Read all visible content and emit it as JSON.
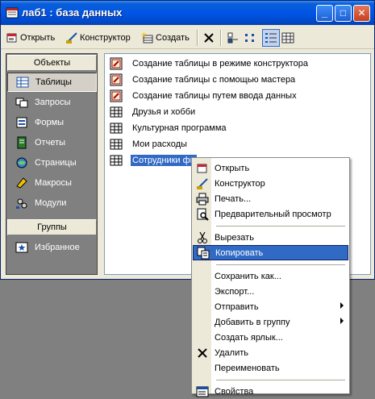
{
  "window": {
    "title": "лаб1 : база данных",
    "controls": {
      "minimize": "_",
      "maximize": "□",
      "close": "✕"
    }
  },
  "toolbar": {
    "open_label": "Открыть",
    "designer_label": "Конструктор",
    "create_label": "Создать"
  },
  "sidebar": {
    "objects_header": "Объекты",
    "groups_header": "Группы",
    "items": [
      {
        "label": "Таблицы",
        "icon": "table-icon",
        "selected": true
      },
      {
        "label": "Запросы",
        "icon": "query-icon"
      },
      {
        "label": "Формы",
        "icon": "form-icon"
      },
      {
        "label": "Отчеты",
        "icon": "report-icon"
      },
      {
        "label": "Страницы",
        "icon": "page-icon"
      },
      {
        "label": "Макросы",
        "icon": "macro-icon"
      },
      {
        "label": "Модули",
        "icon": "module-icon"
      }
    ],
    "favorites_label": "Избранное"
  },
  "list": {
    "items": [
      {
        "label": "Создание таблицы в режиме конструктора",
        "type": "wizard"
      },
      {
        "label": "Создание таблицы с помощью мастера",
        "type": "wizard"
      },
      {
        "label": "Создание таблицы путем ввода данных",
        "type": "wizard"
      },
      {
        "label": "Друзья и хобби",
        "type": "table"
      },
      {
        "label": "Культурная программа",
        "type": "table"
      },
      {
        "label": "Мои расходы",
        "type": "table"
      },
      {
        "label": "Сотрудники фи",
        "type": "table",
        "selected": true
      }
    ]
  },
  "context_menu": {
    "open": "Открыть",
    "designer": "Конструктор",
    "print": "Печать...",
    "preview": "Предварительный просмотр",
    "cut": "Вырезать",
    "copy": "Копировать",
    "save_as": "Сохранить как...",
    "export": "Экспорт...",
    "send": "Отправить",
    "add_to_group": "Добавить в группу",
    "create_shortcut": "Создать ярлык...",
    "delete": "Удалить",
    "rename": "Переименовать",
    "properties": "Свойства"
  },
  "colors": {
    "selection": "#316ac5",
    "title_blue": "#0055e5",
    "face": "#ece9d8"
  }
}
